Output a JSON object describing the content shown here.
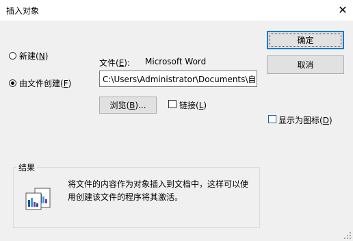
{
  "window": {
    "title": "插入对象",
    "close_glyph": "✕"
  },
  "options": {
    "create_new": {
      "label": "新建",
      "hotkey": "N",
      "checked": false
    },
    "create_from_file": {
      "label": "由文件创建",
      "hotkey": "F",
      "checked": true
    }
  },
  "file": {
    "label": "文件",
    "hotkey": "E",
    "suffix": ":",
    "app_name": "Microsoft Word",
    "path": "C:\\Users\\Administrator\\Documents\\自定"
  },
  "buttons": {
    "browse": {
      "label": "浏览",
      "hotkey": "B",
      "suffix": "..."
    },
    "ok": {
      "label": "确定"
    },
    "cancel": {
      "label": "取消"
    }
  },
  "link": {
    "label": "链接",
    "hotkey": "L",
    "checked": false
  },
  "display_as_icon": {
    "label": "显示为图标",
    "hotkey": "D",
    "checked": false
  },
  "result": {
    "legend": "结果",
    "text": "将文件的内容作为对象插入到文档中，这样可以使用创建该文件的程序将其激活。"
  },
  "colors": {
    "accent": "#0078d7",
    "background": "#f0f0f0"
  }
}
